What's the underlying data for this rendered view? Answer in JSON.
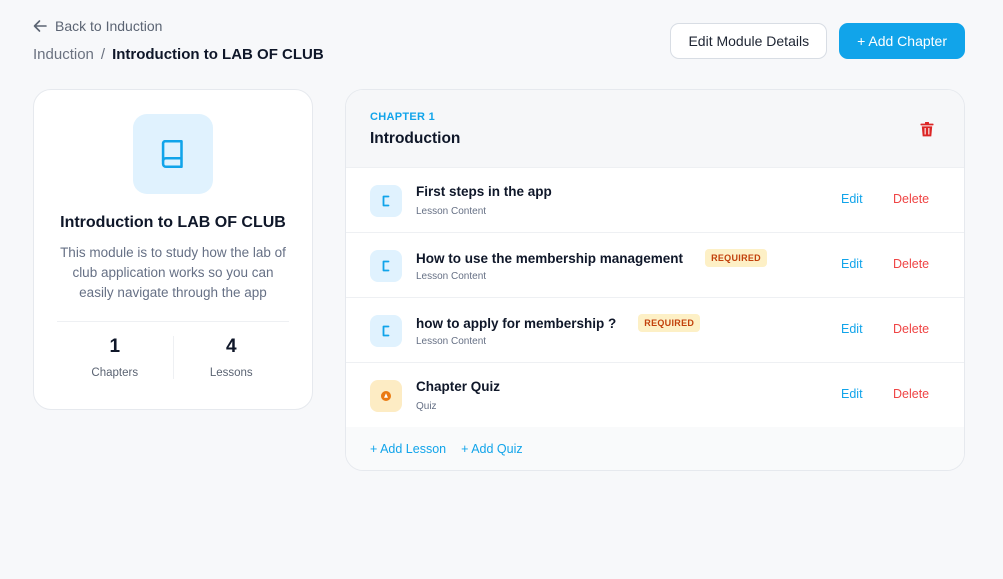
{
  "header": {
    "back_label": "Back to Induction",
    "breadcrumb_parent": "Induction",
    "breadcrumb_separator": "/",
    "breadcrumb_current": "Introduction to LAB OF CLUB",
    "edit_module_label": "Edit Module Details",
    "add_chapter_label": "+ Add Chapter"
  },
  "module": {
    "title": "Introduction to LAB OF CLUB",
    "description": "This module is to study how the lab of club application works so you can easily navigate through the app",
    "stats": [
      {
        "value": "1",
        "label": "Chapters"
      },
      {
        "value": "4",
        "label": "Lessons"
      }
    ]
  },
  "chapter": {
    "kicker": "CHAPTER 1",
    "title": "Introduction",
    "lessons": [
      {
        "name": "First steps in the app",
        "type": "Lesson Content",
        "required": "",
        "icon": "document-icon"
      },
      {
        "name": "How to use the membership management",
        "type": "Lesson Content",
        "required": "REQUIRED",
        "icon": "document-icon"
      },
      {
        "name": "how to apply for membership ?",
        "type": "Lesson Content",
        "required": "REQUIRED",
        "icon": "document-icon"
      },
      {
        "name": "Chapter Quiz",
        "type": "Quiz",
        "required": "",
        "icon": "quiz-icon"
      }
    ],
    "edit_label": "Edit",
    "delete_label": "Delete",
    "add_lesson_label": "+ Add Lesson",
    "add_quiz_label": "+ Add Quiz"
  },
  "colors": {
    "accent": "#11a4ea",
    "danger": "#ef4444",
    "required_bg": "#fdf0c6",
    "required_text": "#c2410c"
  }
}
